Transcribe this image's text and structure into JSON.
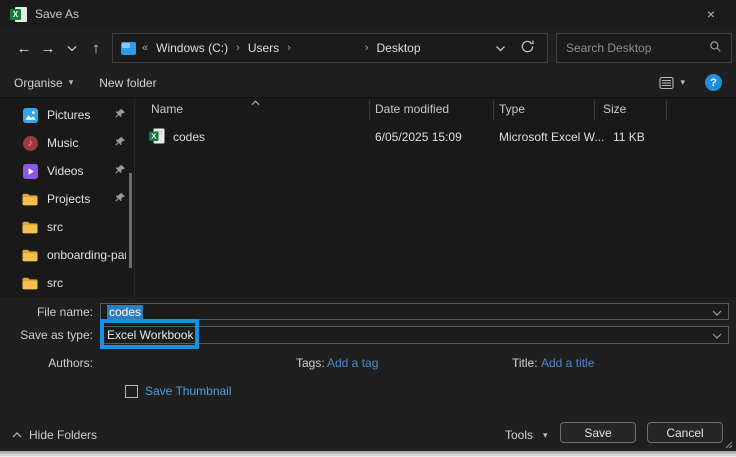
{
  "window": {
    "title": "Save As"
  },
  "icons": {
    "close": "×",
    "back": "←",
    "forward": "→",
    "up": "↑",
    "dropdown": "▾",
    "overflow": "«",
    "separator": "›",
    "music_note": "♪",
    "help": "?",
    "excel_x": "X"
  },
  "colors": {
    "annotation_blue": "#1493e6",
    "selection_blue": "#2d7dbf",
    "link_blue": "#4e87c7",
    "thumbnail_blue": "#4da0e0",
    "help_blue": "#1e8fd9",
    "folder_yellow": "#f5c14e",
    "excel_green": "#107c41"
  },
  "nav": {
    "breadcrumb": {
      "segments": [
        "Windows (C:)",
        "Users",
        "Desktop"
      ]
    },
    "search_placeholder": "Search Desktop"
  },
  "toolbar": {
    "organise_label": "Organise",
    "new_folder_label": "New folder"
  },
  "sidebar": {
    "items": [
      {
        "label": "Pictures",
        "icon": "pictures-icon",
        "pinned": true
      },
      {
        "label": "Music",
        "icon": "music-icon",
        "pinned": true
      },
      {
        "label": "Videos",
        "icon": "videos-icon",
        "pinned": true
      },
      {
        "label": "Projects",
        "icon": "folder-icon",
        "pinned": true
      },
      {
        "label": "src",
        "icon": "folder-icon",
        "pinned": false
      },
      {
        "label": "onboarding-par",
        "icon": "folder-icon",
        "pinned": false
      },
      {
        "label": "src",
        "icon": "folder-icon",
        "pinned": false
      }
    ]
  },
  "list": {
    "columns": [
      "Name",
      "Date modified",
      "Type",
      "Size"
    ],
    "rows": [
      {
        "name": "codes",
        "date_modified": "6/05/2025 15:09",
        "type": "Microsoft Excel W...",
        "size": "11 KB"
      }
    ]
  },
  "form": {
    "file_name_label": "File name:",
    "file_name_value": "codes",
    "save_as_type_label": "Save as type:",
    "save_as_type_value": "Excel Workbook",
    "authors_label": "Authors:",
    "tags_label": "Tags:",
    "add_tag_link": "Add a tag",
    "title_label": "Title:",
    "add_title_link": "Add a title",
    "save_thumbnail_label": "Save Thumbnail"
  },
  "footer": {
    "hide_folders_label": "Hide Folders",
    "tools_label": "Tools",
    "save_label": "Save",
    "cancel_label": "Cancel"
  }
}
